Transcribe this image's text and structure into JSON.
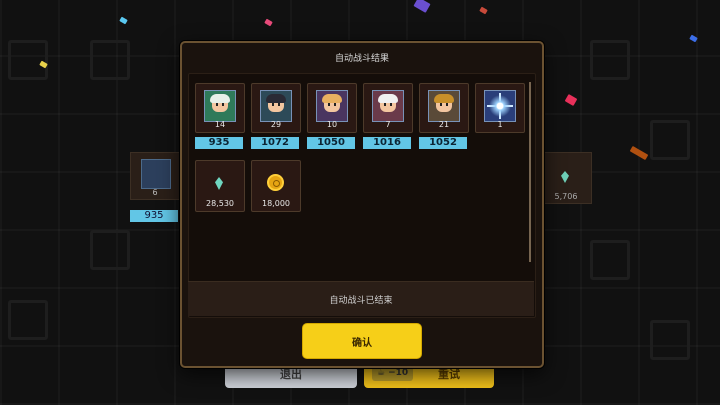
{
  "modal": {
    "title": "自动战斗结果",
    "status_text": "自动战斗已结束",
    "confirm_label": "确认"
  },
  "rewards": {
    "characters": [
      {
        "name": "green-hair-hero",
        "count": "14",
        "power": "935"
      },
      {
        "name": "dark-hair-hero",
        "count": "29",
        "power": "1072"
      },
      {
        "name": "orange-hair-hero",
        "count": "10",
        "power": "1050"
      },
      {
        "name": "white-hair-hero",
        "count": "7",
        "power": "1016"
      },
      {
        "name": "warrior-hero",
        "count": "21",
        "power": "1052"
      },
      {
        "name": "sparkle-item",
        "count": "1",
        "power": ""
      }
    ],
    "items": [
      {
        "name": "gem",
        "count": "28,530"
      },
      {
        "name": "gold-coin",
        "count": "18,000"
      }
    ]
  },
  "background": {
    "card_count": "6",
    "card_power": "935",
    "gem_total": "5,706",
    "quit_label": "退出",
    "retry_cost": "−10",
    "retry_label": "重试"
  },
  "colors": {
    "badge": "#62c6e6",
    "confirm": "#f6cf18",
    "panel_border": "#6b5231"
  }
}
